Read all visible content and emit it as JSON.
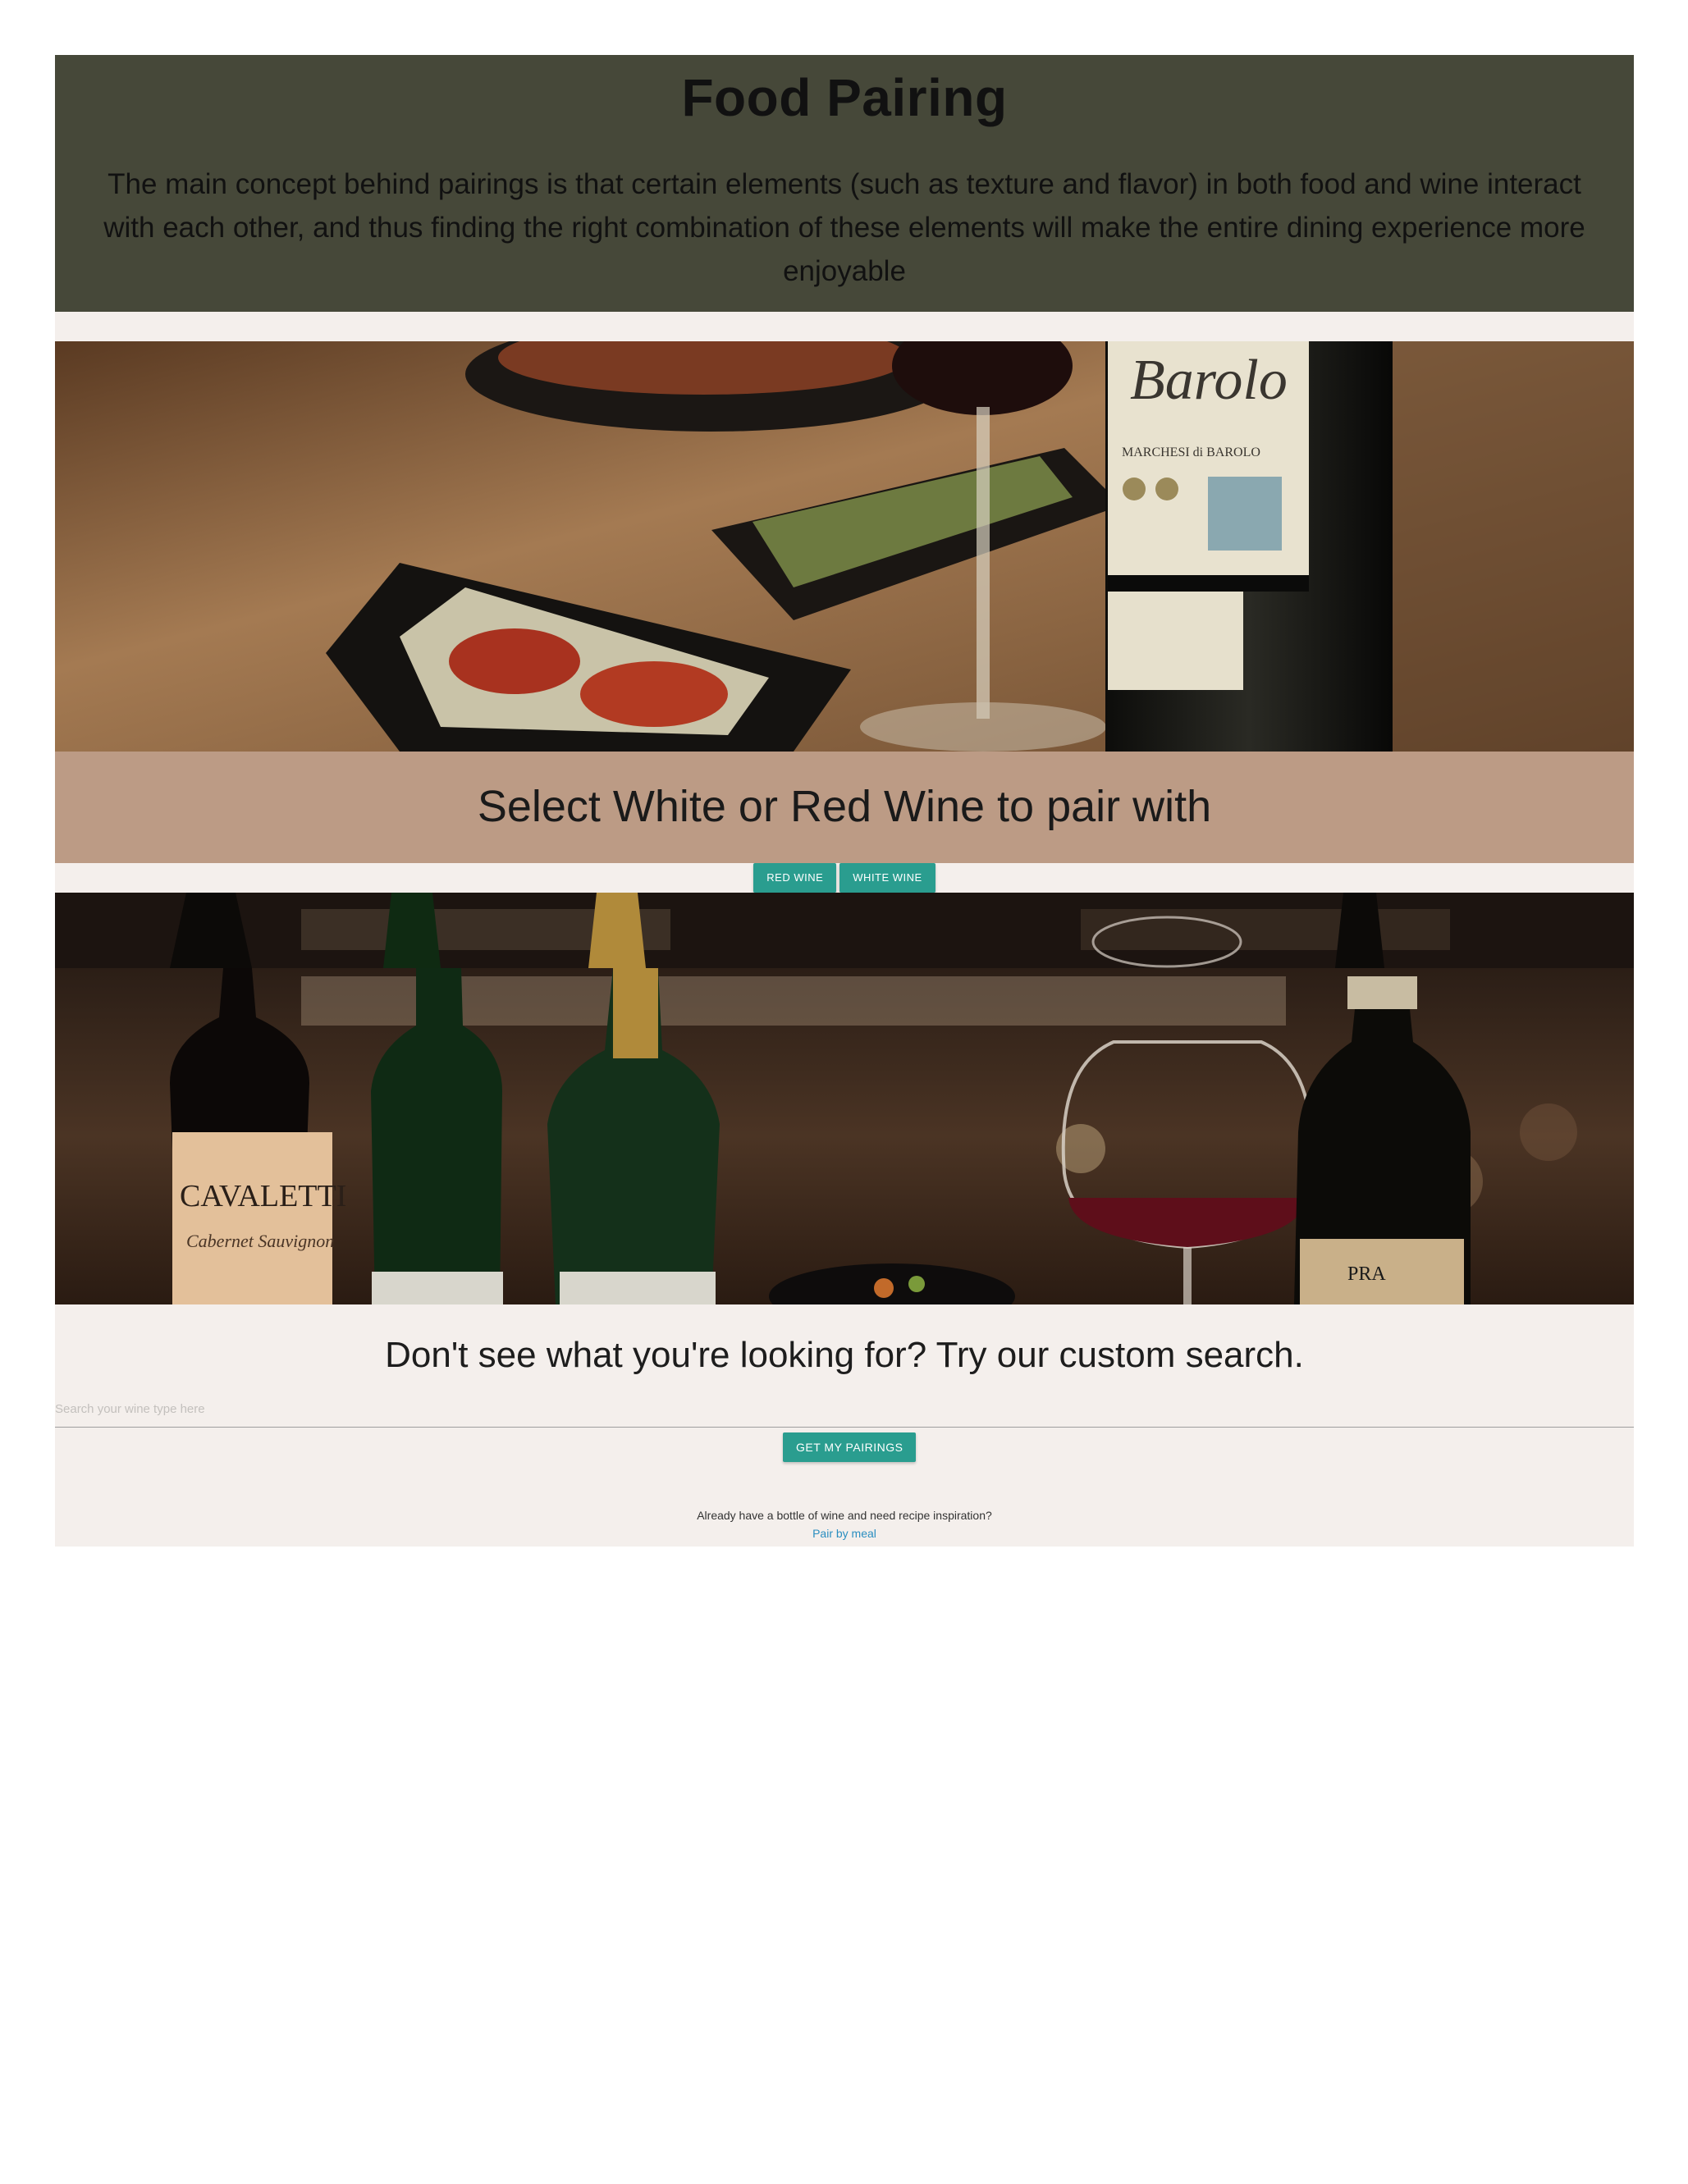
{
  "header": {
    "title": "Food Pairing",
    "description": "The main concept behind pairings is that certain elements (such as texture and flavor) in both food and wine interact with each other, and thus finding the right combination of these elements will make the entire dining experience more enjoyable"
  },
  "hero_photo": {
    "bottle_label_script": "Barolo",
    "bottle_label_small": "MARCHESI di BAROLO"
  },
  "pairing": {
    "heading": "Select White or Red Wine to pair with",
    "red_button": "RED WINE",
    "white_button": "WHITE WINE"
  },
  "wine_photo": {
    "bottle_label_brand": "CAVALETTI",
    "bottle_label_variety": "Cabernet Sauvignon",
    "bottle_label_pra": "PRA"
  },
  "search": {
    "heading": "Don't see what you're looking for? Try our custom search.",
    "placeholder": "Search your wine type here",
    "value": "",
    "button": "GET MY PAIRINGS"
  },
  "footer": {
    "inspiration_text": "Already have a bottle of wine and need recipe inspiration?",
    "link_text": "Pair by meal"
  },
  "colors": {
    "header_bg": "#464839",
    "band_bg": "#bc9b85",
    "page_bg": "#f4efec",
    "button_teal": "#2a9d8f",
    "link_blue": "#2a8ec0"
  }
}
